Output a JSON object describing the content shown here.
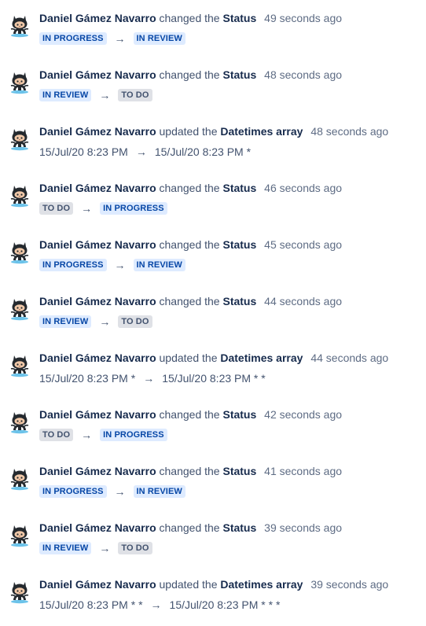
{
  "entries": [
    {
      "author": "Daniel Gámez Navarro",
      "action": "changed the",
      "field": "Status",
      "time": "49 seconds ago",
      "kind": "status",
      "from": {
        "text": "IN PROGRESS",
        "tone": "blue"
      },
      "to": {
        "text": "IN REVIEW",
        "tone": "blue"
      }
    },
    {
      "author": "Daniel Gámez Navarro",
      "action": "changed the",
      "field": "Status",
      "time": "48 seconds ago",
      "kind": "status",
      "from": {
        "text": "IN REVIEW",
        "tone": "blue"
      },
      "to": {
        "text": "TO DO",
        "tone": "gray"
      }
    },
    {
      "author": "Daniel Gámez Navarro",
      "action": "updated the",
      "field": "Datetimes array",
      "time": "48 seconds ago",
      "kind": "text",
      "from": {
        "text": "15/Jul/20 8:23 PM"
      },
      "to": {
        "text": "15/Jul/20 8:23 PM *"
      }
    },
    {
      "author": "Daniel Gámez Navarro",
      "action": "changed the",
      "field": "Status",
      "time": "46 seconds ago",
      "kind": "status",
      "from": {
        "text": "TO DO",
        "tone": "gray"
      },
      "to": {
        "text": "IN PROGRESS",
        "tone": "blue"
      }
    },
    {
      "author": "Daniel Gámez Navarro",
      "action": "changed the",
      "field": "Status",
      "time": "45 seconds ago",
      "kind": "status",
      "from": {
        "text": "IN PROGRESS",
        "tone": "blue"
      },
      "to": {
        "text": "IN REVIEW",
        "tone": "blue"
      }
    },
    {
      "author": "Daniel Gámez Navarro",
      "action": "changed the",
      "field": "Status",
      "time": "44 seconds ago",
      "kind": "status",
      "from": {
        "text": "IN REVIEW",
        "tone": "blue"
      },
      "to": {
        "text": "TO DO",
        "tone": "gray"
      }
    },
    {
      "author": "Daniel Gámez Navarro",
      "action": "updated the",
      "field": "Datetimes array",
      "time": "44 seconds ago",
      "kind": "text",
      "from": {
        "text": "15/Jul/20 8:23 PM *"
      },
      "to": {
        "text": "15/Jul/20 8:23 PM * *"
      }
    },
    {
      "author": "Daniel Gámez Navarro",
      "action": "changed the",
      "field": "Status",
      "time": "42 seconds ago",
      "kind": "status",
      "from": {
        "text": "TO DO",
        "tone": "gray"
      },
      "to": {
        "text": "IN PROGRESS",
        "tone": "blue"
      }
    },
    {
      "author": "Daniel Gámez Navarro",
      "action": "changed the",
      "field": "Status",
      "time": "41 seconds ago",
      "kind": "status",
      "from": {
        "text": "IN PROGRESS",
        "tone": "blue"
      },
      "to": {
        "text": "IN REVIEW",
        "tone": "blue"
      }
    },
    {
      "author": "Daniel Gámez Navarro",
      "action": "changed the",
      "field": "Status",
      "time": "39 seconds ago",
      "kind": "status",
      "from": {
        "text": "IN REVIEW",
        "tone": "blue"
      },
      "to": {
        "text": "TO DO",
        "tone": "gray"
      }
    },
    {
      "author": "Daniel Gámez Navarro",
      "action": "updated the",
      "field": "Datetimes array",
      "time": "39 seconds ago",
      "kind": "text",
      "from": {
        "text": "15/Jul/20 8:23 PM * *"
      },
      "to": {
        "text": "15/Jul/20 8:23 PM * * *"
      }
    }
  ],
  "arrow_glyph": "→",
  "avatar_icon": "octocat-avatar-icon",
  "colors": {
    "lozenge_blue_bg": "#deebff",
    "lozenge_blue_text": "#0747a6",
    "lozenge_gray_bg": "#dfe1e6",
    "lozenge_gray_text": "#42526e"
  }
}
